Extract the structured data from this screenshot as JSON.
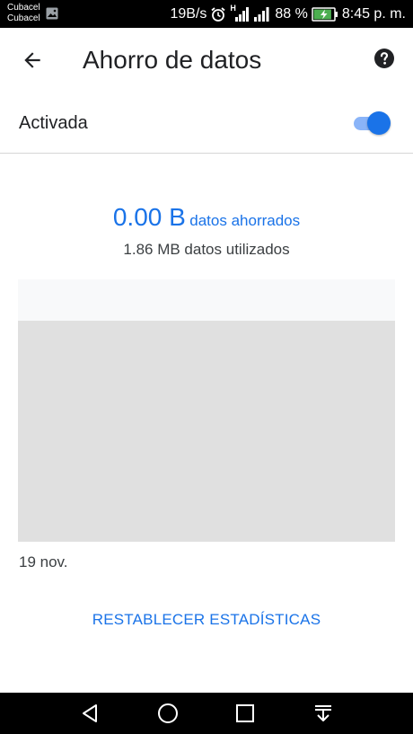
{
  "status_bar": {
    "carrier1": "Cubacel",
    "carrier2": "Cubacel",
    "speed": "19B/s",
    "network_type": "H",
    "battery_percent": "88 %",
    "battery_level": 0.88,
    "time": "8:45 p. m."
  },
  "header": {
    "title": "Ahorro de datos",
    "back_icon": "arrow-back-icon",
    "help_icon": "help-circle-icon"
  },
  "toggle": {
    "label": "Activada",
    "checked": true,
    "accent": "#1a73e8"
  },
  "stats": {
    "saved_amount": "0.00 B",
    "saved_text": "datos ahorrados",
    "used_text": "1.86 MB datos utilizados"
  },
  "chart": {
    "date_label": "19 nov."
  },
  "actions": {
    "reset_label": "RESTABLECER ESTADÍSTICAS"
  },
  "nav_bar": {
    "icons": [
      "back-triangle-icon",
      "home-circle-icon",
      "recents-square-icon",
      "notification-pulldown-icon"
    ]
  }
}
